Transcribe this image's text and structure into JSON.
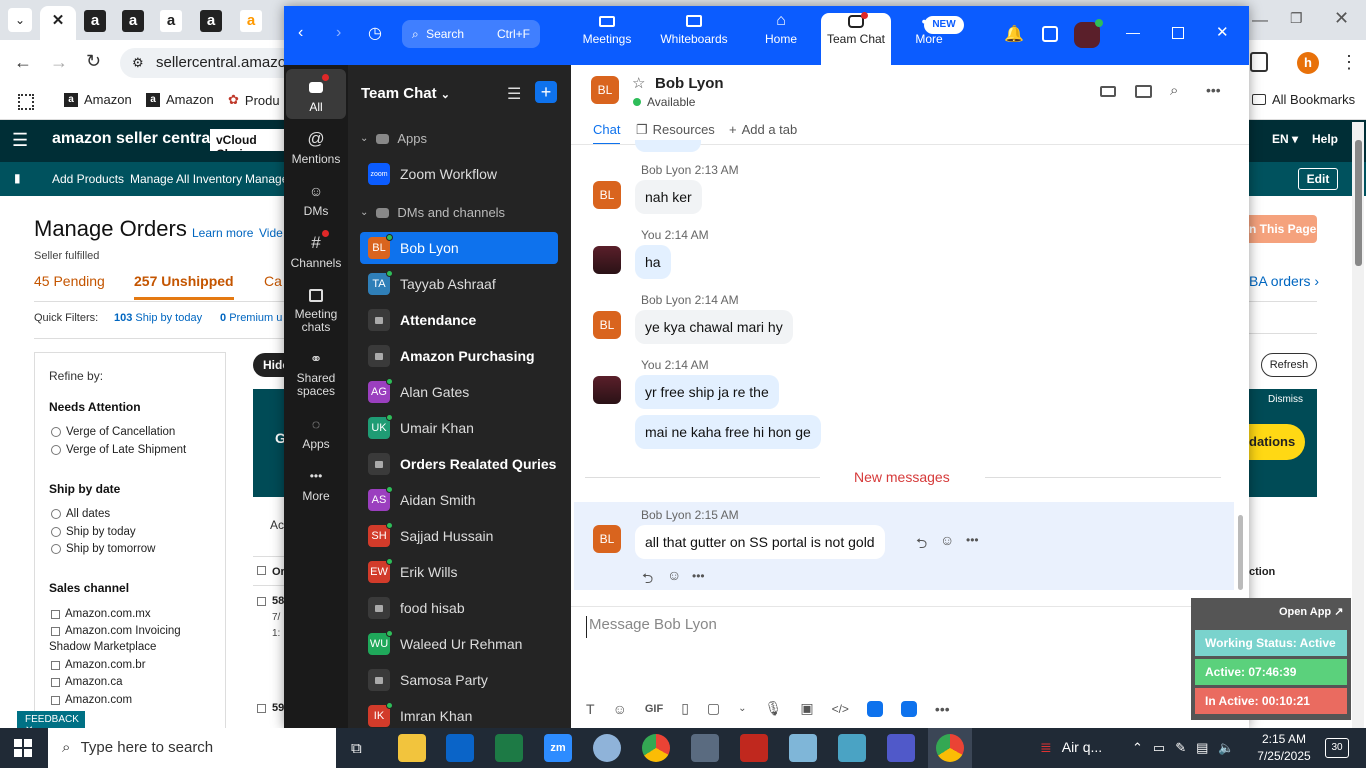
{
  "browser": {
    "tab_letters": [
      "a",
      "a",
      "a",
      "a"
    ],
    "address": "sellercentral.amazon",
    "bookmarks": [
      "Amazon",
      "Amazon",
      "Produ"
    ],
    "all_bookmarks": "All Bookmarks",
    "profile_initial": "h"
  },
  "amazon": {
    "logo": "amazon seller central",
    "store": "vCloud Choic",
    "lang": "EN",
    "help": "Help",
    "nav": [
      "Add Products",
      "Manage All Inventory",
      "Manage"
    ],
    "edit": "Edit",
    "page_title": "Manage Orders",
    "learn_more": "Learn more",
    "video": "Videc",
    "seller_fulfilled": "Seller fulfilled",
    "pending_count": "45",
    "pending_label": "Pending",
    "unshipped_count": "257",
    "unshipped_label": "Unshipped",
    "canceled_partial": "Ca",
    "quick_filters": "Quick Filters:",
    "ship_today_count": "103",
    "ship_today": "Ship by today",
    "premium_count": "0",
    "premium": "Premium u",
    "fba_orders": "BA orders ›",
    "this_page": "n This Page",
    "refresh": "Refresh",
    "dismiss": "Dismiss",
    "recommendations": "dations",
    "hide": "Hide",
    "action": "ction",
    "row1_id": "58",
    "row1_date": "7/",
    "row1_time": "1:",
    "row2_id": "59",
    "order_col": "Or",
    "ac_partial": "Ac",
    "g_partial": "G",
    "feedback": "FEEDBACK ✕",
    "refine": {
      "title": "Refine by:",
      "needs_attention": "Needs Attention",
      "attention_opts": [
        "Verge of Cancellation",
        "Verge of Late Shipment"
      ],
      "ship_by_date": "Ship by date",
      "ship_opts": [
        "All dates",
        "Ship by today",
        "Ship by tomorrow"
      ],
      "sales_channel": "Sales channel",
      "channel_opts": [
        "Amazon.com.mx",
        "Amazon.com Invoicing",
        "Shadow Marketplace",
        "Amazon.com.br",
        "Amazon.ca",
        "Amazon.com"
      ]
    }
  },
  "zoom": {
    "search_placeholder": "Search",
    "search_shortcut": "Ctrl+F",
    "top_tabs": [
      "Meetings",
      "Whiteboards",
      "Home",
      "Team Chat",
      "More"
    ],
    "new_badge": "NEW",
    "rail": [
      "All",
      "Mentions",
      "DMs",
      "Channels",
      "Meeting chats",
      "Shared spaces",
      "Apps",
      "More"
    ],
    "list_title": "Team Chat",
    "apps_section": "Apps",
    "zoom_workflow": "Zoom Workflow",
    "dms_section": "DMs and channels",
    "items": [
      {
        "name": "Bob Lyon",
        "initials": "BL",
        "color": "#d9641e",
        "type": "dm",
        "active": true,
        "bold": false
      },
      {
        "name": "Tayyab Ashraaf",
        "initials": "TA",
        "color": "#2f7fb8",
        "type": "dm",
        "active": false,
        "bold": false
      },
      {
        "name": "Attendance",
        "initials": "",
        "color": "",
        "type": "lock",
        "active": false,
        "bold": true
      },
      {
        "name": "Amazon Purchasing",
        "initials": "",
        "color": "",
        "type": "lock",
        "active": false,
        "bold": true
      },
      {
        "name": "Alan Gates",
        "initials": "AG",
        "color": "#9b3fbf",
        "type": "dm",
        "active": false,
        "bold": false
      },
      {
        "name": "Umair Khan",
        "initials": "UK",
        "color": "#1f9c74",
        "type": "dm",
        "active": false,
        "bold": false
      },
      {
        "name": "Orders Realated Quries",
        "initials": "",
        "color": "",
        "type": "lock",
        "active": false,
        "bold": true
      },
      {
        "name": "Aidan Smith",
        "initials": "AS",
        "color": "#9b3fbf",
        "type": "dm",
        "active": false,
        "bold": false
      },
      {
        "name": "Sajjad Hussain",
        "initials": "SH",
        "color": "#d23b2a",
        "type": "dm",
        "active": false,
        "bold": false
      },
      {
        "name": "Erik Wills",
        "initials": "EW",
        "color": "#d23b2a",
        "type": "dm",
        "active": false,
        "bold": false
      },
      {
        "name": "food hisab",
        "initials": "",
        "color": "",
        "type": "lock",
        "active": false,
        "bold": false
      },
      {
        "name": "Waleed Ur Rehman",
        "initials": "WU",
        "color": "#1fa85a",
        "type": "dm",
        "active": false,
        "bold": false
      },
      {
        "name": "Samosa Party",
        "initials": "",
        "color": "",
        "type": "lock",
        "active": false,
        "bold": false
      },
      {
        "name": "Imran Khan",
        "initials": "IK",
        "color": "#d23b2a",
        "type": "dm",
        "active": false,
        "bold": false
      }
    ],
    "chat": {
      "contact": "Bob Lyon",
      "initials": "BL",
      "status": "Available",
      "tabs": [
        "Chat",
        "Resources",
        "Add a tab"
      ],
      "messages": [
        {
          "who": "Bob Lyon",
          "time": "2:13 AM",
          "text": "nah ker",
          "me": false
        },
        {
          "who": "You",
          "time": "2:14 AM",
          "text": "ha",
          "me": true
        },
        {
          "who": "Bob Lyon",
          "time": "2:14 AM",
          "text": "ye kya chawal mari hy",
          "me": false
        },
        {
          "who": "You",
          "time": "2:14 AM",
          "text": "yr free ship ja re the",
          "me": true
        },
        {
          "who": "",
          "time": "",
          "text": "mai ne kaha free hi hon ge",
          "me": true
        }
      ],
      "new_messages": "New messages",
      "last_message": {
        "who": "Bob Lyon",
        "time": "2:15 AM",
        "text": "all that gutter on SS portal is not gold"
      },
      "composer_placeholder": "Message Bob Lyon",
      "gif": "GIF"
    }
  },
  "widget": {
    "open_app": "Open App ↗",
    "working_status": "Working Status: Active",
    "active": "Active: 07:46:39",
    "inactive": "In Active: 00:10:21"
  },
  "taskbar": {
    "search_placeholder": "Type here to search",
    "weather": "Air q...",
    "time": "2:15 AM",
    "date": "7/25/2025",
    "notif_count": "30"
  }
}
